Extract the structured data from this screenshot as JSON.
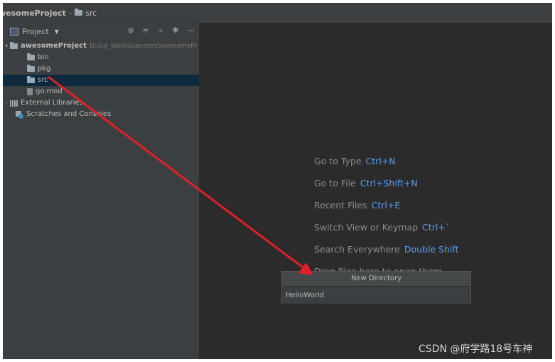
{
  "breadcrumb": {
    "project": "wesomeProject",
    "folder": "src"
  },
  "panel": {
    "title": "Project",
    "tools": [
      "globe-icon",
      "expand-all-icon",
      "collapse-all-icon",
      "gear-icon",
      "minimize-icon"
    ]
  },
  "tree": {
    "root": {
      "name": "awesomeProject",
      "path": "D:\\Go_WorkSpace\\src\\awesomePr"
    },
    "children": [
      {
        "name": "bin"
      },
      {
        "name": "pkg"
      },
      {
        "name": "src"
      },
      {
        "name": "go.mod"
      }
    ],
    "external": "External Libraries",
    "scratches": "Scratches and Consoles"
  },
  "hints": [
    {
      "label": "Go to Type",
      "key": "Ctrl+N"
    },
    {
      "label": "Go to File",
      "key": "Ctrl+Shift+N"
    },
    {
      "label": "Recent Files",
      "key": "Ctrl+E"
    },
    {
      "label": "Switch View or Keymap",
      "key": "Ctrl+`"
    },
    {
      "label": "Search Everywhere",
      "key": "Double Shift"
    },
    {
      "label": "Drop files here to open them",
      "key": ""
    }
  ],
  "dialog": {
    "title": "New Directory",
    "value": "HelloWorld"
  },
  "watermark": "CSDN @府学路18号车神",
  "colors": {
    "selection": "#0d293e",
    "shortcut": "#589df6",
    "arrow": "#e21f26"
  }
}
